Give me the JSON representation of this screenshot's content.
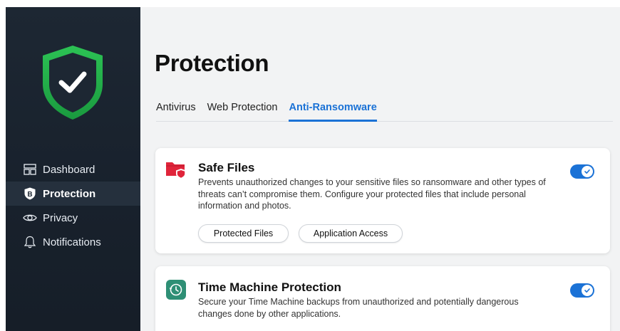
{
  "sidebar": {
    "items": [
      {
        "label": "Dashboard",
        "icon": "dashboard-icon",
        "active": false
      },
      {
        "label": "Protection",
        "icon": "shield-b-icon",
        "active": true
      },
      {
        "label": "Privacy",
        "icon": "eye-icon",
        "active": false
      },
      {
        "label": "Notifications",
        "icon": "bell-icon",
        "active": false
      }
    ]
  },
  "main": {
    "title": "Protection",
    "tabs": [
      {
        "label": "Antivirus",
        "active": false
      },
      {
        "label": "Web Protection",
        "active": false
      },
      {
        "label": "Anti-Ransomware",
        "active": true
      }
    ],
    "cards": [
      {
        "title": "Safe Files",
        "description": "Prevents unauthorized changes to your sensitive files so ransomware and other types of threats can’t compromise them. Configure your protected files that include personal information and photos.",
        "icon": "folder-shield-icon",
        "enabled": true,
        "buttons": [
          "Protected Files",
          "Application Access"
        ]
      },
      {
        "title": "Time Machine Protection",
        "description": "Secure your Time Machine backups from unauthorized and potentially dangerous changes done by other applications.",
        "icon": "time-machine-icon",
        "enabled": true
      }
    ]
  },
  "colors": {
    "accent": "#1b72d6",
    "shield_green": "#22b14c",
    "sidebar_bg": "#1d2733",
    "folder_red": "#e0243a",
    "time_machine_teal": "#2e8f75"
  }
}
